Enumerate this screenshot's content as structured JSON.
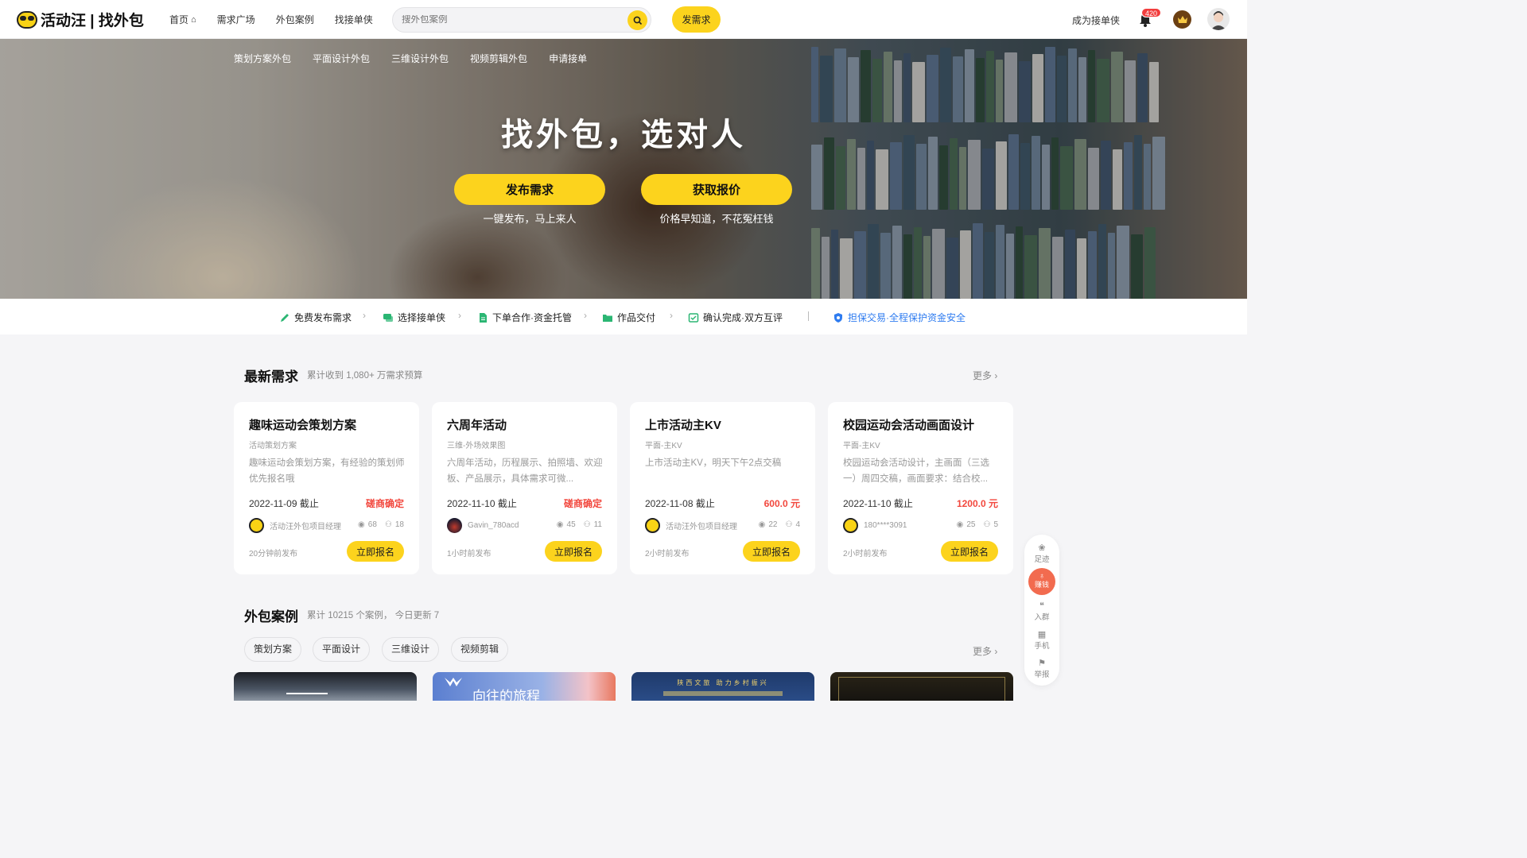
{
  "header": {
    "logo_text": "活动汪 | 找外包",
    "nav": [
      "首页",
      "需求广场",
      "外包案例",
      "找接单侠"
    ],
    "search_placeholder": "搜外包案例",
    "post_button": "发需求",
    "become_provider": "成为接单侠",
    "notification_count": "420"
  },
  "hero": {
    "categories": [
      "策划方案外包",
      "平面设计外包",
      "三维设计外包",
      "视频剪辑外包",
      "申请接单"
    ],
    "title": "找外包，选对人",
    "buttons": [
      {
        "label": "发布需求",
        "sub": "一键发布，马上来人"
      },
      {
        "label": "获取报价",
        "sub": "价格早知道，不花冤枉钱"
      }
    ]
  },
  "steps": [
    "免费发布需求",
    "选择接单侠",
    "下单合作·资金托管",
    "作品交付",
    "确认完成·双方互评"
  ],
  "guarantee": "担保交易·全程保护资金安全",
  "latest": {
    "title": "最新需求",
    "subtitle": "累计收到 1,080+ 万需求预算",
    "more": "更多",
    "cards": [
      {
        "title": "趣味运动会策划方案",
        "tag": "活动策划方案",
        "desc": "趣味运动会策划方案，有经验的策划师优先报名哦",
        "deadline": "2022-11-09 截止",
        "price": "磋商确定",
        "user": "活动汪外包项目经理",
        "views": "68",
        "people": "18",
        "time": "20分钟前发布",
        "apply": "立即报名"
      },
      {
        "title": "六周年活动",
        "tag": "三维-外场效果图",
        "desc": "六周年活动，历程展示、拍照墙、欢迎板、产品展示，具体需求可微...",
        "deadline": "2022-11-10 截止",
        "price": "磋商确定",
        "user": "Gavin_780acd",
        "views": "45",
        "people": "11",
        "time": "1小时前发布",
        "apply": "立即报名"
      },
      {
        "title": "上市活动主KV",
        "tag": "平面-主KV",
        "desc": "上市活动主KV，明天下午2点交稿",
        "deadline": "2022-11-08 截止",
        "price": "600.0 元",
        "user": "活动汪外包项目经理",
        "views": "22",
        "people": "4",
        "time": "2小时前发布",
        "apply": "立即报名"
      },
      {
        "title": "校园运动会活动画面设计",
        "tag": "平面-主KV",
        "desc": "校园运动会活动设计，主画面（三选一）周四交稿，画面要求：结合校...",
        "deadline": "2022-11-10 截止",
        "price": "1200.0 元",
        "user": "180****3091",
        "views": "25",
        "people": "5",
        "time": "2小时前发布",
        "apply": "立即报名"
      }
    ]
  },
  "cases": {
    "title": "外包案例",
    "subtitle": "累计 10215 个案例， 今日更新 7",
    "more": "更多",
    "filters": [
      "策划方案",
      "平面设计",
      "三维设计",
      "视频剪辑"
    ],
    "thumb_texts": [
      "",
      "向往的旅程",
      "陕西文旅 助力乡村振兴",
      ""
    ]
  },
  "side": {
    "items": [
      "足迹",
      "赚钱",
      "入群",
      "手机",
      "举报"
    ]
  }
}
